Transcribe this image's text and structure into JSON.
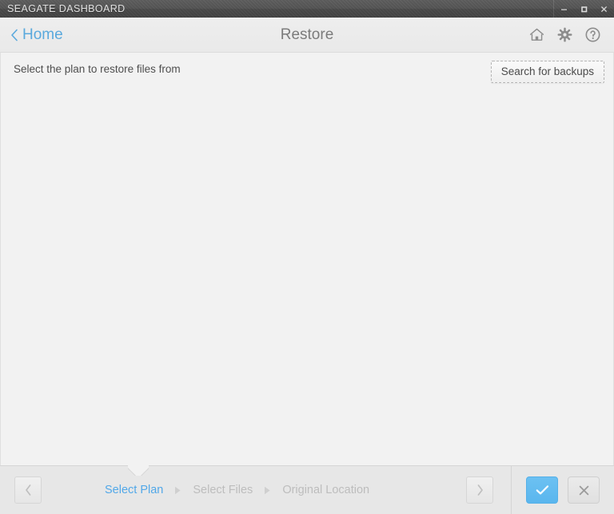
{
  "window": {
    "title": "SEAGATE DASHBOARD",
    "controls": [
      {
        "name": "minimize",
        "label": "–"
      },
      {
        "name": "maximize",
        "label": "□"
      },
      {
        "name": "close",
        "label": "✕"
      }
    ]
  },
  "header": {
    "back_label": "Home",
    "back_icon": "chevron-left-icon",
    "title": "Restore",
    "icons": [
      {
        "name": "home-icon",
        "label": "Home"
      },
      {
        "name": "gear-icon",
        "label": "Settings"
      },
      {
        "name": "help-icon",
        "label": "Help"
      }
    ]
  },
  "content": {
    "hint": "Select the plan to restore files from",
    "search_button": "Search for backups",
    "plans": []
  },
  "footer": {
    "prev_label": "Previous",
    "next_label": "Next",
    "steps": [
      {
        "label": "Select Plan",
        "state": "active"
      },
      {
        "label": "Select Files",
        "state": "inactive"
      },
      {
        "label": "Original Location",
        "state": "inactive"
      }
    ],
    "confirm_label": "Confirm",
    "cancel_label": "Cancel"
  },
  "colors": {
    "accent": "#52a8e8",
    "link": "#5aa9dd",
    "titlebar": "#4f4f4f",
    "header_bg": "#ebebeb",
    "content_bg": "#f2f2f2",
    "footer_bg": "#e7e7e7",
    "muted_text": "#bdbdbd"
  }
}
